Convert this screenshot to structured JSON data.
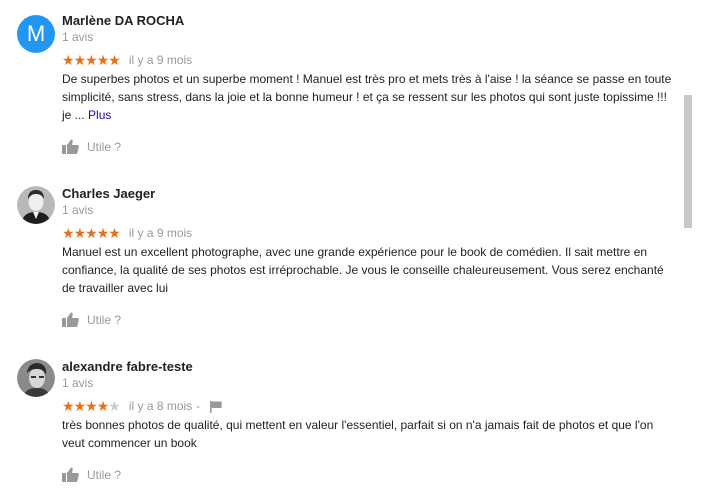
{
  "reviews": [
    {
      "avatar_letter": "M",
      "author": "Marlène DA ROCHA",
      "review_count": "1 avis",
      "stars": 5,
      "date": "il y a 9 mois",
      "text": "De superbes photos et un superbe moment ! Manuel est très pro et mets très à l'aise ! la séance se passe en toute simplicité, sans stress, dans la joie et la bonne humeur ! et ça se ressent sur les photos qui sont juste topissime !!! je ...",
      "more": "Plus",
      "helpful": "Utile ?"
    },
    {
      "author": "Charles Jaeger",
      "review_count": "1 avis",
      "stars": 5,
      "date": "il y a 9 mois",
      "text": "Manuel est un excellent photographe, avec une grande expérience pour le book de comédien. Il sait mettre en confiance, la qualité de ses photos est irréprochable. Je vous le conseille chaleureusement. Vous serez enchanté de travailler avec lui",
      "helpful": "Utile ?"
    },
    {
      "author": "alexandre fabre-teste",
      "review_count": "1 avis",
      "stars": 4,
      "date": "il y a 8 mois",
      "flag_separator": "-",
      "text": "très bonnes photos de qualité, qui mettent en valeur l'essentiel, parfait si on n'a jamais fait de photos et que l'on veut commencer un book",
      "helpful": "Utile ?"
    }
  ],
  "colors": {
    "star_filled": "#e7711b",
    "star_empty": "#cccccc",
    "avatar_m": "#2196f3",
    "link": "#1a0dab",
    "muted": "#999999"
  }
}
